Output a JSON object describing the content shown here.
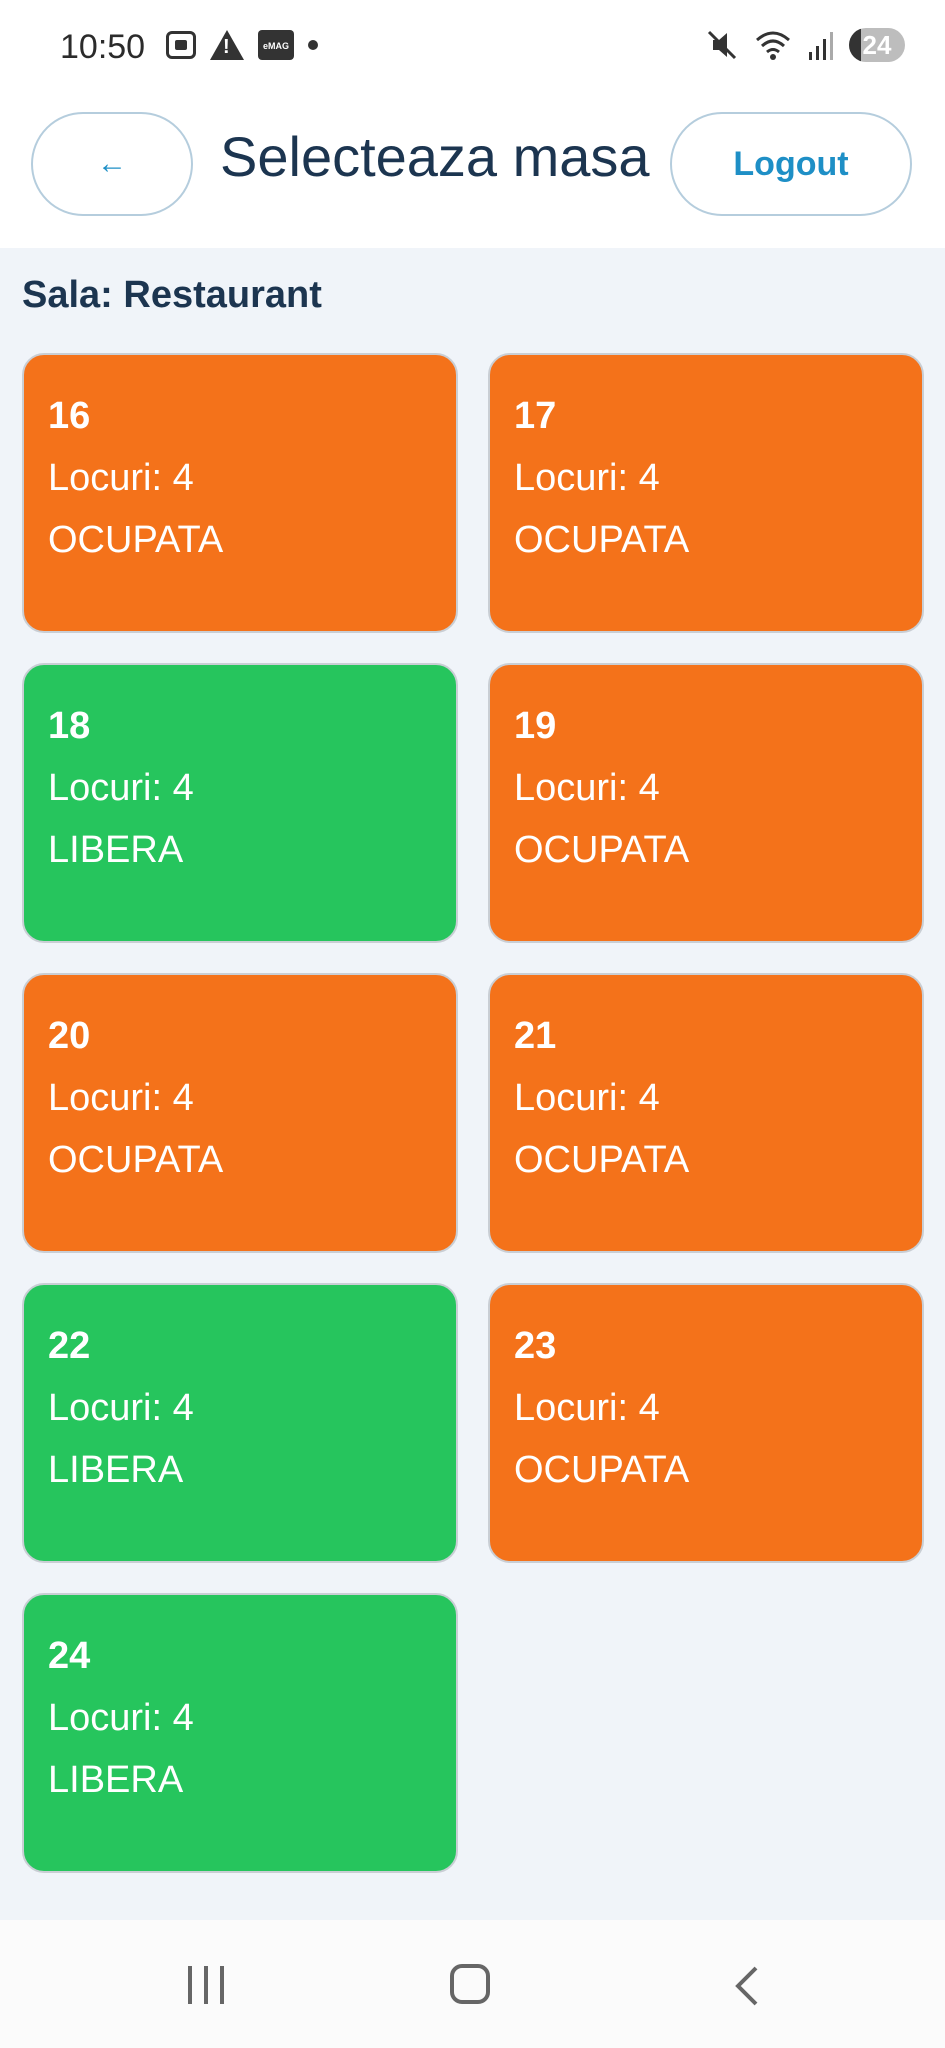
{
  "status_bar": {
    "time": "10:50",
    "emag_label": "eMAG",
    "battery": "24"
  },
  "header": {
    "back_label": "←",
    "title": "Selecteaza masa",
    "logout_label": "Logout"
  },
  "sala": {
    "label": "Sala: Restaurant"
  },
  "tables": [
    {
      "number": "16",
      "seats": "Locuri: 4",
      "status": "OCUPATA"
    },
    {
      "number": "17",
      "seats": "Locuri: 4",
      "status": "OCUPATA"
    },
    {
      "number": "18",
      "seats": "Locuri: 4",
      "status": "LIBERA"
    },
    {
      "number": "19",
      "seats": "Locuri: 4",
      "status": "OCUPATA"
    },
    {
      "number": "20",
      "seats": "Locuri: 4",
      "status": "OCUPATA"
    },
    {
      "number": "21",
      "seats": "Locuri: 4",
      "status": "OCUPATA"
    },
    {
      "number": "22",
      "seats": "Locuri: 4",
      "status": "LIBERA"
    },
    {
      "number": "23",
      "seats": "Locuri: 4",
      "status": "OCUPATA"
    },
    {
      "number": "24",
      "seats": "Locuri: 4",
      "status": "LIBERA"
    }
  ],
  "colors": {
    "ocupata": "#f4721a",
    "libera": "#26c55d",
    "accent": "#1e8fc6",
    "title": "#1c3550"
  }
}
